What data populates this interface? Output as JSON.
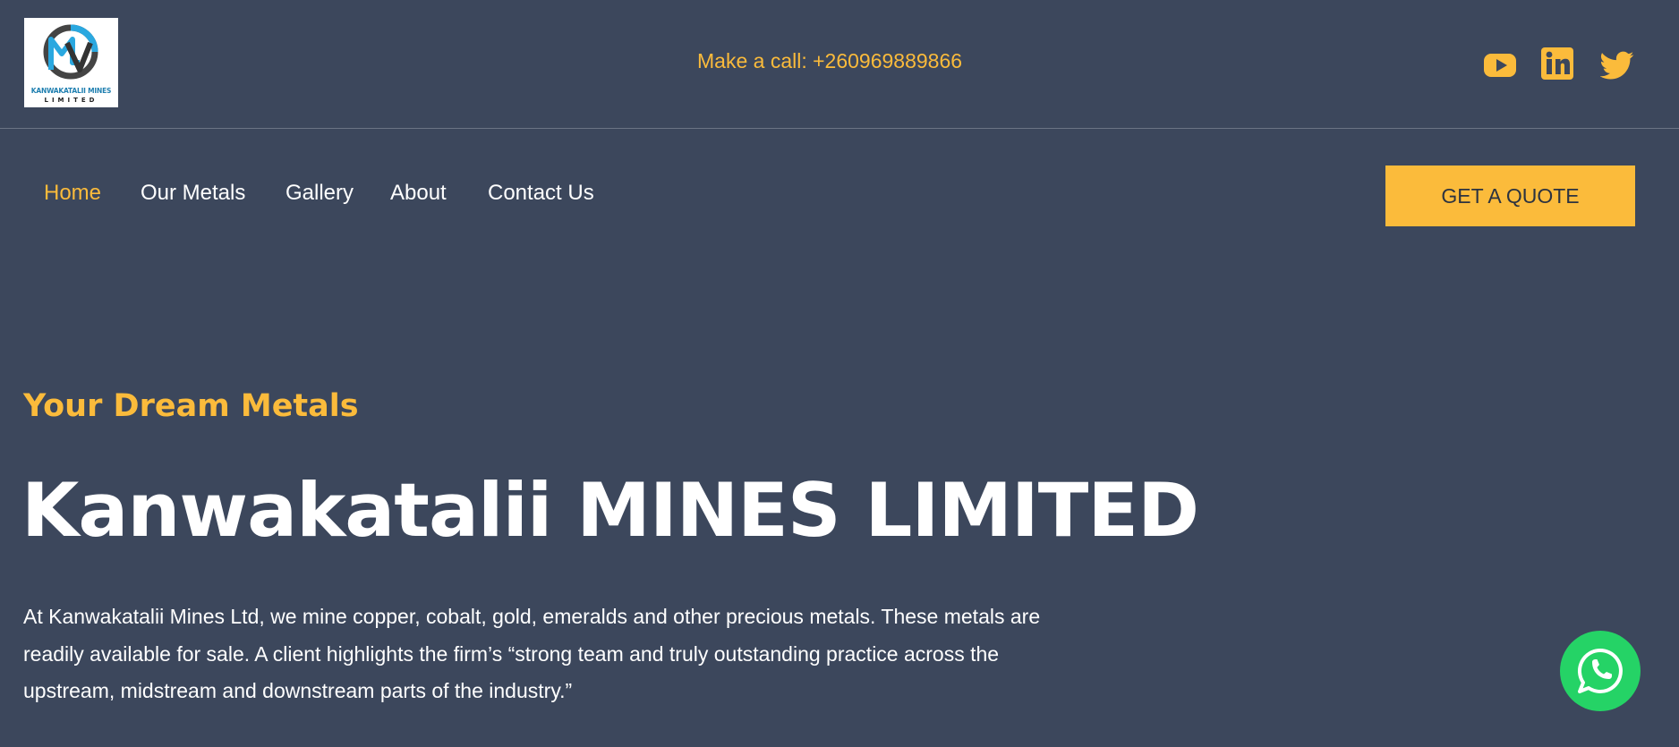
{
  "header": {
    "logo": {
      "line1": "KANWAKATALII MINES",
      "line2": "LIMITED",
      "brand_color": "#1f7fb0"
    },
    "phone_text": "Make a call: +260969889866",
    "social_icons": [
      "youtube-icon",
      "linkedin-icon",
      "twitter-icon"
    ]
  },
  "nav": {
    "items": [
      {
        "label": "Home",
        "active": true
      },
      {
        "label": "Our Metals",
        "active": false
      },
      {
        "label": "Gallery",
        "active": false
      },
      {
        "label": "About",
        "active": false
      },
      {
        "label": "Contact Us",
        "active": false
      }
    ],
    "cta_label": "GET A QUOTE"
  },
  "hero": {
    "kicker": "Your Dream Metals",
    "title": "Kanwakatalii MINES LIMITED",
    "body": "At Kanwakatalii Mines Ltd, we mine copper, cobalt, gold, emeralds and other precious metals. These metals are readily available for sale. A client highlights the firm’s “strong team and truly outstanding practice across the upstream, midstream and downstream parts of the industry.”"
  },
  "floating": {
    "icon": "whatsapp-icon"
  },
  "colors": {
    "background": "#3c475c",
    "accent": "#fbbb3b",
    "whatsapp": "#25d366",
    "text": "#ffffff"
  }
}
